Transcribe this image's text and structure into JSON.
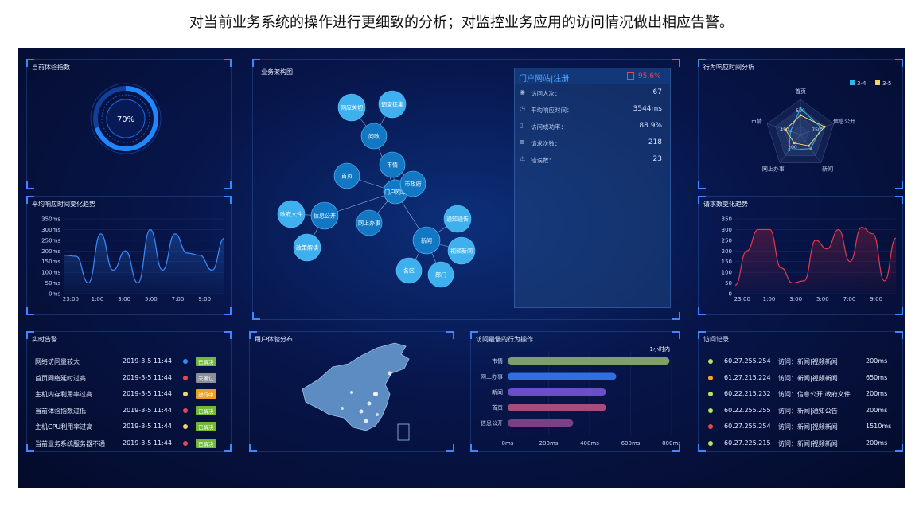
{
  "caption": "对当前业务系统的操作进行更细致的分析；对监控业务应用的访问情况做出相应告警。",
  "colors": {
    "accent": "#3f86ff",
    "green": "#7ed321",
    "yellow": "#f5c342",
    "red": "#e9474e",
    "blue": "#2f8ff2"
  },
  "experience": {
    "title": "当前体验指数",
    "value": "70%",
    "fraction": 0.7
  },
  "response_trend": {
    "title": "平均响应时间变化趋势",
    "chart_data": {
      "type": "area",
      "x": [
        "23:00",
        "1:00",
        "3:00",
        "5:00",
        "7:00",
        "9:00"
      ],
      "y_ticks": [
        "350ms",
        "300ms",
        "250ms",
        "200ms",
        "150ms",
        "100ms",
        "50ms",
        "0ms"
      ],
      "ylim": [
        0,
        350
      ],
      "values": [
        180,
        175,
        50,
        280,
        110,
        200,
        50,
        300,
        110,
        280,
        190,
        180,
        110,
        260
      ]
    }
  },
  "architecture": {
    "title": "业务架构图",
    "nodes": [
      "门户网站",
      "问政",
      "网应关切",
      "调查征集",
      "市情",
      "市政府",
      "首页",
      "信息公开",
      "政府文件",
      "政策解读",
      "网上办事",
      "新闻",
      "通知通告",
      "视频新闻",
      "部门",
      "各区"
    ]
  },
  "portal_info": {
    "title": "门户网站|注册",
    "alert": "95.6%",
    "rows": [
      {
        "icon": "user-icon",
        "label": "访问人次：",
        "value": "67"
      },
      {
        "icon": "clock-icon",
        "label": "平均响应时间：",
        "value": "3544ms"
      },
      {
        "icon": "file-icon",
        "label": "访问成功率：",
        "value": "88.9%"
      },
      {
        "icon": "list-icon",
        "label": "请求次数：",
        "value": "218"
      },
      {
        "icon": "warning-icon",
        "label": "错误数：",
        "value": "23"
      }
    ]
  },
  "radar": {
    "title": "行为响应时间分析",
    "legend": [
      {
        "name": "3-4",
        "color": "#2fb6ea"
      },
      {
        "name": "3-5",
        "color": "#f5d36b"
      }
    ],
    "chart_data": {
      "type": "radar",
      "axes": [
        "首页",
        "信息公开",
        "新闻",
        "网上办事",
        "市情"
      ],
      "ticks": [
        "500",
        "750",
        "450",
        "200"
      ],
      "series": [
        {
          "name": "3-4",
          "values": [
            0.75,
            0.62,
            0.5,
            0.55,
            0.3
          ]
        },
        {
          "name": "3-5",
          "values": [
            0.55,
            0.72,
            0.4,
            0.3,
            0.45
          ]
        }
      ]
    }
  },
  "request_trend": {
    "title": "请求数变化趋势",
    "chart_data": {
      "type": "area",
      "x": [
        "23:00",
        "1:00",
        "3:00",
        "5:00",
        "7:00",
        "9:00"
      ],
      "y_ticks": [
        "350",
        "300",
        "250",
        "200",
        "150",
        "100",
        "50",
        "0"
      ],
      "ylim": [
        0,
        350
      ],
      "values": [
        40,
        200,
        300,
        300,
        120,
        50,
        60,
        250,
        210,
        300,
        150,
        310,
        280,
        60,
        260
      ]
    }
  },
  "alerts": {
    "title": "实时告警",
    "rows": [
      {
        "text": "网络访问量较大",
        "time": "2019-3-5 11:44",
        "dot": "#2f8ff2",
        "status": "已解决",
        "badge": "#6fb83a"
      },
      {
        "text": "首页网络延时过高",
        "time": "2019-3-5 11:44",
        "dot": "#e9474e",
        "status": "未确认",
        "badge": "#8a8f99"
      },
      {
        "text": "主机内存利用率过高",
        "time": "2019-3-5 11:44",
        "dot": "#f5d36b",
        "status": "进行中",
        "badge": "#e8a31f"
      },
      {
        "text": "当前体验指数过低",
        "time": "2019-3-5 11:44",
        "dot": "#e9474e",
        "status": "已解决",
        "badge": "#6fb83a"
      },
      {
        "text": "主机CPU利用率过高",
        "time": "2019-3-5 11:44",
        "dot": "#f5d36b",
        "status": "已解决",
        "badge": "#6fb83a"
      },
      {
        "text": "当前业务系统服务器不通",
        "time": "2019-3-5 11:44",
        "dot": "#e9474e",
        "status": "已解决",
        "badge": "#6fb83a"
      }
    ]
  },
  "map": {
    "title": "用户体验分布"
  },
  "slowest": {
    "title": "访问最慢的行为操作",
    "marker": "1小时内",
    "chart_data": {
      "type": "bar",
      "orientation": "horizontal",
      "categories": [
        "市情",
        "网上办事",
        "新闻",
        "首页",
        "信息公开"
      ],
      "values": [
        790,
        530,
        480,
        480,
        320
      ],
      "colors": [
        "#7e9f6a",
        "#2f6fe0",
        "#6a4fc9",
        "#a64e7a",
        "#7a3f85"
      ],
      "ticks": [
        "0ms",
        "200ms",
        "400ms",
        "600ms",
        "800ms"
      ],
      "xlim": [
        0,
        800
      ]
    }
  },
  "records": {
    "title": "访问记录",
    "rows": [
      {
        "dot": "#b8e25f",
        "ip": "60.27.255.254",
        "desc": "访问：新闻|视频新闻",
        "ms": "200ms"
      },
      {
        "dot": "#f5a623",
        "ip": "61.27.215.224",
        "desc": "访问：新闻|视频新闻",
        "ms": "650ms"
      },
      {
        "dot": "#b8e25f",
        "ip": "60.22.215.232",
        "desc": "访问：信息公开|政府文件",
        "ms": "200ms"
      },
      {
        "dot": "#b8e25f",
        "ip": "60.22.255.255",
        "desc": "访问：新闻|通知公告",
        "ms": "200ms"
      },
      {
        "dot": "#e9474e",
        "ip": "60.27.255.254",
        "desc": "访问：新闻|视频新闻",
        "ms": "1510ms"
      },
      {
        "dot": "#b8e25f",
        "ip": "60.27.225.215",
        "desc": "访问：新闻|视频新闻",
        "ms": "200ms"
      }
    ]
  }
}
